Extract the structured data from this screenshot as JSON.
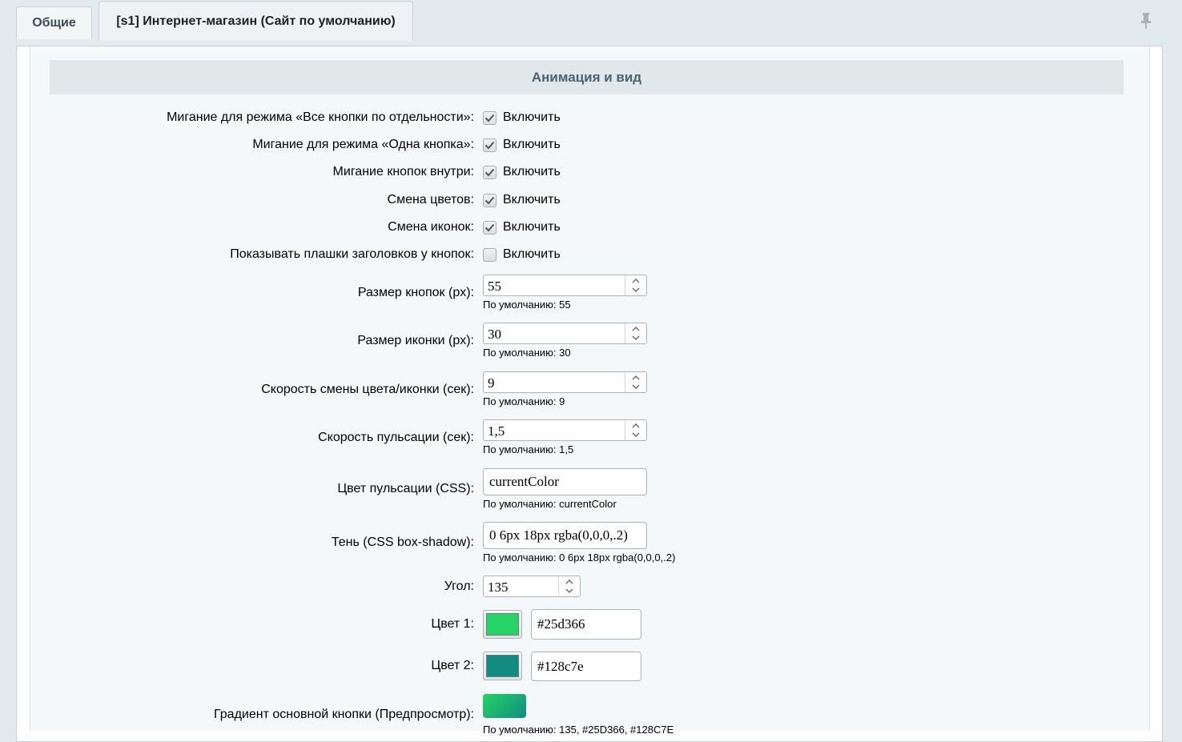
{
  "tabs": {
    "general": "Общие",
    "site": "[s1] Интернет-магазин (Сайт по умолчанию)"
  },
  "section_title": "Анимация и вид",
  "checkboxes": [
    {
      "label": "Мигание для режима «Все кнопки по отдельности»:",
      "text": "Включить",
      "checked": true
    },
    {
      "label": "Мигание для режима «Одна кнопка»:",
      "text": "Включить",
      "checked": true
    },
    {
      "label": "Мигание кнопок внутри:",
      "text": "Включить",
      "checked": true
    },
    {
      "label": "Смена цветов:",
      "text": "Включить",
      "checked": true
    },
    {
      "label": "Смена иконок:",
      "text": "Включить",
      "checked": true
    },
    {
      "label": "Показывать плашки заголовков у кнопок:",
      "text": "Включить",
      "checked": false
    }
  ],
  "spinners": [
    {
      "label": "Размер кнопок (px):",
      "value": "55",
      "hint": "По умолчанию: 55"
    },
    {
      "label": "Размер иконки (px):",
      "value": "30",
      "hint": "По умолчанию: 30"
    },
    {
      "label": "Скорость смены цвета/иконки (сек):",
      "value": "9",
      "hint": "По умолчанию: 9"
    },
    {
      "label": "Скорость пульсации (сек):",
      "value": "1,5",
      "hint": "По умолчанию: 1,5"
    }
  ],
  "pulse_color": {
    "label": "Цвет пульсации (CSS):",
    "value": "currentColor",
    "hint": "По умолчанию: currentColor"
  },
  "shadow": {
    "label": "Тень (CSS box-shadow):",
    "value": "0 6px 18px rgba(0,0,0,.2)",
    "hint": "По умолчанию: 0 6px 18px rgba(0,0,0,.2)"
  },
  "angle": {
    "label": "Угол:",
    "value": "135"
  },
  "color1": {
    "label": "Цвет 1:",
    "value": "#25d366",
    "swatch": "#25d366"
  },
  "color2": {
    "label": "Цвет 2:",
    "value": "#128c7e",
    "swatch": "#128c7e"
  },
  "gradient": {
    "label": "Градиент основной кнопки (Предпросмотр):",
    "hint": "По умолчанию: 135, #25D366, #128C7E"
  },
  "icons": {
    "pin": "pin-icon",
    "check": "checkmark-icon",
    "spin": "spin-arrows-icon"
  }
}
